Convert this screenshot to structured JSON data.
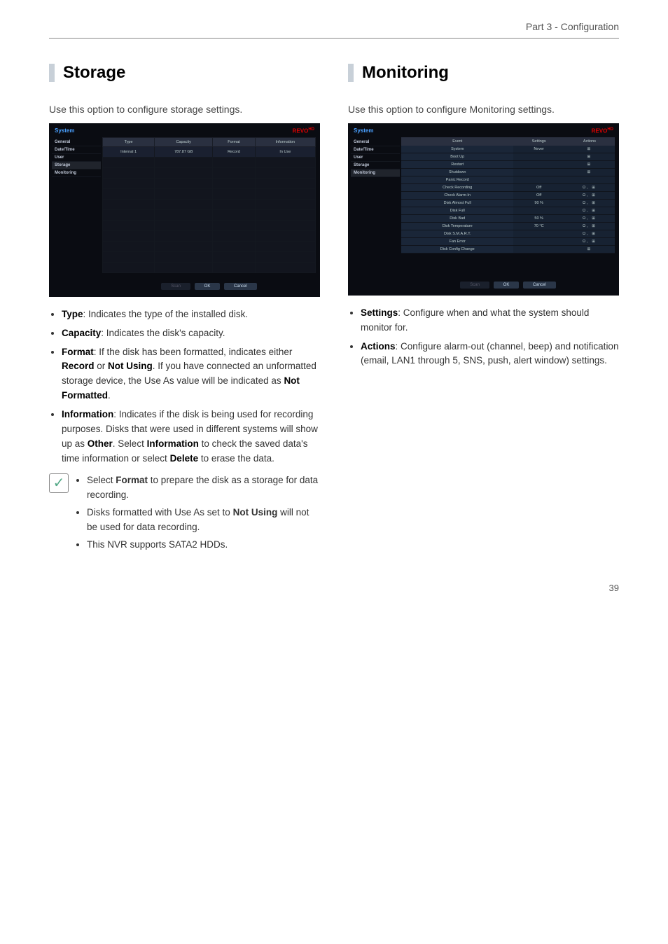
{
  "header": {
    "part": "Part 3 - Configuration"
  },
  "page_number": "39",
  "storage": {
    "title": "Storage",
    "intro": "Use this option to configure storage settings.",
    "shot": {
      "system_label": "System",
      "brand": "REVO",
      "brand_suffix": "HD",
      "sidebar": [
        "General",
        "Date/Time",
        "User",
        "Storage",
        "Monitoring"
      ],
      "active_index": 3,
      "headers": [
        "Type",
        "Capacity",
        "Format",
        "Information"
      ],
      "row": {
        "type": "Internal 1",
        "capacity": "787.87 GB",
        "format": "Record",
        "info": "In Use"
      },
      "buttons": {
        "scan": "Scan",
        "ok": "OK",
        "cancel": "Cancel"
      }
    },
    "bullets": [
      {
        "label": "Type",
        "text": ": Indicates the type of the installed disk."
      },
      {
        "label": "Capacity",
        "text": ": Indicates the disk's capacity."
      },
      {
        "label": "Format",
        "text_a": ": If the disk has been formatted, indicates either ",
        "b1": "Record",
        "mid": " or ",
        "b2": "Not Using",
        "text_b": ". If you have connected an unformatted storage device, the Use As value will be indicated as ",
        "b3": "Not Formatted",
        "text_c": "."
      },
      {
        "label": "Information",
        "text_a": ": Indicates if the disk is being used for recording purposes. Disks that were used in different systems will show up as ",
        "b1": "Other",
        "text_b": ". Select ",
        "b2": "Information",
        "text_c": " to check the saved data's time information or select ",
        "b3": "Delete",
        "text_d": " to erase the data."
      }
    ],
    "notes": [
      {
        "a": "Select ",
        "b": "Format",
        "c": " to prepare the disk as a storage for data recording."
      },
      {
        "a": "Disks formatted with Use As set to ",
        "b": "Not Using",
        "c": " will not be used for data recording."
      },
      {
        "a": "This NVR supports SATA2 HDDs.",
        "b": "",
        "c": ""
      }
    ]
  },
  "monitoring": {
    "title": "Monitoring",
    "intro": "Use this option to configure Monitoring settings.",
    "shot": {
      "system_label": "System",
      "brand": "REVO",
      "brand_suffix": "HD",
      "sidebar": [
        "General",
        "Date/Time",
        "User",
        "Storage",
        "Monitoring"
      ],
      "active_index": 4,
      "headers": [
        "Event",
        "Settings",
        "Actions"
      ],
      "rows": [
        {
          "event": "System",
          "settings": "Never",
          "actions": "⊞"
        },
        {
          "event": "Boot Up",
          "settings": "",
          "actions": "⊞"
        },
        {
          "event": "Restart",
          "settings": "",
          "actions": "⊞"
        },
        {
          "event": "Shutdown",
          "settings": "",
          "actions": "⊞"
        },
        {
          "event": "Panic Record",
          "settings": "",
          "actions": ""
        },
        {
          "event": "Check Recording",
          "settings": "Off",
          "actions": "Ω, ⊞"
        },
        {
          "event": "Check Alarm-In",
          "settings": "Off",
          "actions": "Ω, ⊞"
        },
        {
          "event": "Disk Almost Full",
          "settings": "90 %",
          "actions": "Ω, ⊞"
        },
        {
          "event": "Disk Full",
          "settings": "",
          "actions": "Ω, ⊞"
        },
        {
          "event": "Disk Bad",
          "settings": "50 %",
          "actions": "Ω, ⊞"
        },
        {
          "event": "Disk Temperature",
          "settings": "70 °C",
          "actions": "Ω, ⊞"
        },
        {
          "event": "Disk S.M.A.R.T.",
          "settings": "",
          "actions": "Ω, ⊞"
        },
        {
          "event": "Fan Error",
          "settings": "",
          "actions": "Ω, ⊞"
        },
        {
          "event": "Disk Config Change",
          "settings": "",
          "actions": "⊞"
        }
      ],
      "buttons": {
        "scan": "Scan",
        "ok": "OK",
        "cancel": "Cancel"
      }
    },
    "bullets": [
      {
        "label": "Settings",
        "text": ": Configure when and what the system should monitor for."
      },
      {
        "label": "Actions",
        "text": ": Configure alarm-out (channel, beep) and notification (email, LAN1 through 5, SNS, push, alert window) settings."
      }
    ]
  }
}
